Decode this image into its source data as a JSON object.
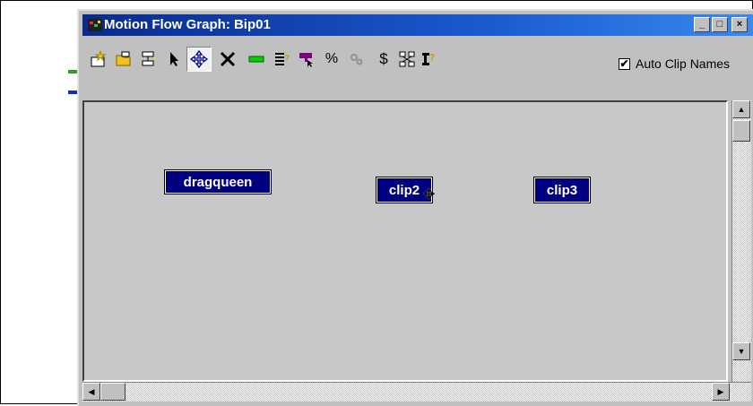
{
  "window": {
    "title": "Motion Flow Graph: Bip01",
    "minimize_label": "_",
    "maximize_label": "□",
    "close_label": "×"
  },
  "toolbar": {
    "tools": [
      {
        "name": "create-clip-icon",
        "glyph": "✦"
      },
      {
        "name": "open-folder-icon",
        "glyph": "⌂"
      },
      {
        "name": "add-transition-icon",
        "glyph": "⊞"
      },
      {
        "name": "select-arrow-icon",
        "glyph": "➤"
      },
      {
        "name": "move-icon",
        "glyph": "✛"
      },
      {
        "name": "delete-icon",
        "glyph": "✕"
      },
      {
        "name": "green-bar-icon",
        "glyph": "▬"
      },
      {
        "name": "properties-icon",
        "glyph": "≡"
      },
      {
        "name": "select-random-icon",
        "glyph": "▼"
      },
      {
        "name": "percent-icon",
        "glyph": "%"
      },
      {
        "name": "optimize-icon",
        "glyph": "⚙"
      },
      {
        "name": "dollar-icon",
        "glyph": "$"
      },
      {
        "name": "layout-icon",
        "glyph": "⌘"
      },
      {
        "name": "info-icon",
        "glyph": "⫶"
      }
    ],
    "auto_clip_names_label": "Auto Clip Names",
    "auto_clip_names_checked": "✔"
  },
  "graph": {
    "nodes": [
      {
        "label": "dragqueen"
      },
      {
        "label": "clip2"
      },
      {
        "label": "clip3"
      }
    ],
    "cursor_glyph": "✥"
  },
  "colors": {
    "titlebar_start": "#0a2a8c",
    "titlebar_end": "#3a8bf0",
    "node_fill": "#000080",
    "canvas_bg": "#c8c8c8"
  }
}
